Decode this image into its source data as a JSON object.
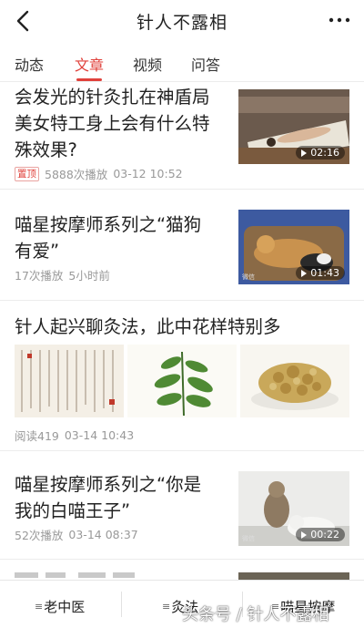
{
  "header": {
    "title": "针人不露相"
  },
  "tabs": [
    {
      "label": "动态"
    },
    {
      "label": "文章"
    },
    {
      "label": "视频"
    },
    {
      "label": "问答"
    }
  ],
  "articles": [
    {
      "title_line1": "会发光的针灸扎在神盾局",
      "title_line2": "美女特工身上会有什么特",
      "title_line3": "殊效果?",
      "badge": "置顶",
      "plays": "5888次播放",
      "date": "03-12 10:52",
      "duration": "02:16"
    },
    {
      "title_line1": "喵星按摩师系列之“猫狗",
      "title_line2": "有爱”",
      "plays": "17次播放",
      "date": "5小时前",
      "duration": "01:43"
    },
    {
      "title_line1": "针人起兴聊灸法，此中花样特别多",
      "reads": "阅读419",
      "date": "03-14 10:43"
    },
    {
      "title_line1": "喵星按摩师系列之“你是",
      "title_line2": "我的白喵王子”",
      "plays": "52次播放",
      "date": "03-14 08:37",
      "duration": "00:22"
    }
  ],
  "bottom_nav": [
    {
      "label": "老中医"
    },
    {
      "label": "灸法"
    },
    {
      "label": "喵星按摩"
    }
  ],
  "watermark": "头条号 / 针人不露相",
  "colors": {
    "accent": "#e0413b",
    "meta": "#999999",
    "divider": "#ececec"
  }
}
